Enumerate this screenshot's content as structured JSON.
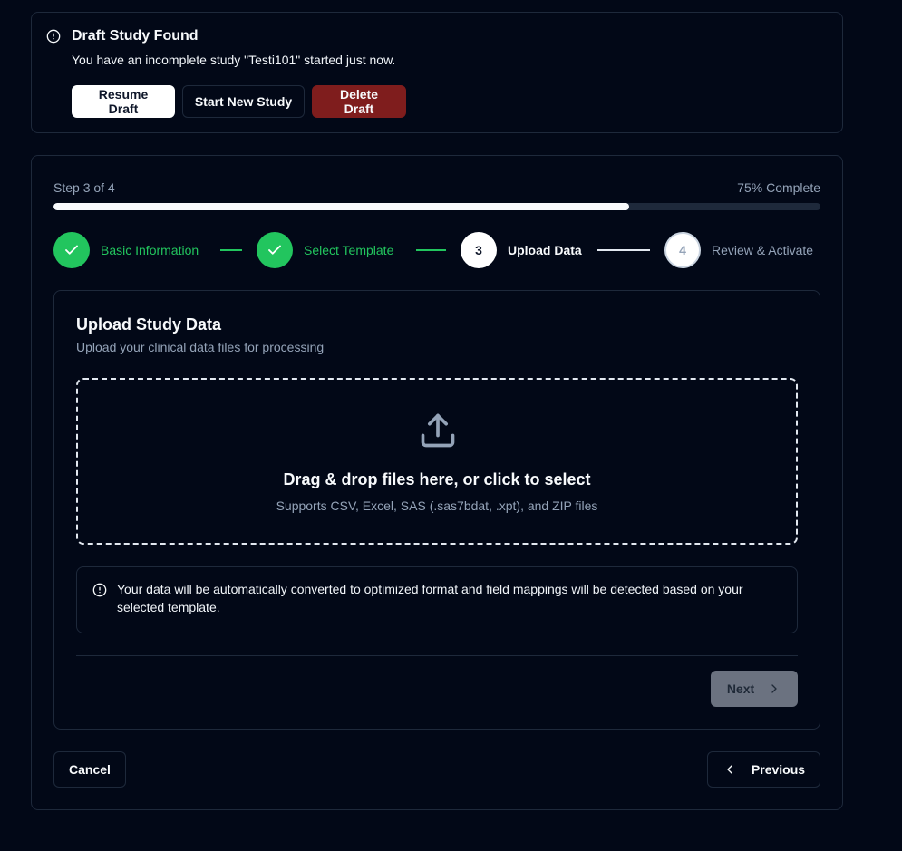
{
  "draft_alert": {
    "title": "Draft Study Found",
    "message": "You have an incomplete study \"Testi101\" started just now.",
    "resume_label": "Resume Draft",
    "new_label": "Start New Study",
    "delete_label": "Delete Draft",
    "icon": "alert-circle-icon"
  },
  "wizard": {
    "step_text": "Step 3 of 4",
    "percent_text": "75% Complete",
    "progress": 0.75,
    "steps": [
      {
        "number": "1",
        "label": "Basic Information",
        "state": "done"
      },
      {
        "number": "2",
        "label": "Select Template",
        "state": "done"
      },
      {
        "number": "3",
        "label": "Upload Data",
        "state": "active"
      },
      {
        "number": "4",
        "label": "Review & Activate",
        "state": "pending"
      }
    ],
    "cancel_label": "Cancel",
    "previous_label": "Previous"
  },
  "upload": {
    "title": "Upload Study Data",
    "subtitle": "Upload your clinical data files for processing",
    "dropzone_title": "Drag & drop files here, or click to select",
    "dropzone_sub": "Supports CSV, Excel, SAS (.sas7bdat, .xpt), and ZIP files",
    "info_text": "Your data will be automatically converted to optimized format and field mappings will be detected based on your selected template.",
    "next_label": "Next"
  },
  "colors": {
    "background": "#020817",
    "success": "#22c55e",
    "danger": "#7f1d1d",
    "border": "#1e293b",
    "muted": "#94a3b8"
  }
}
